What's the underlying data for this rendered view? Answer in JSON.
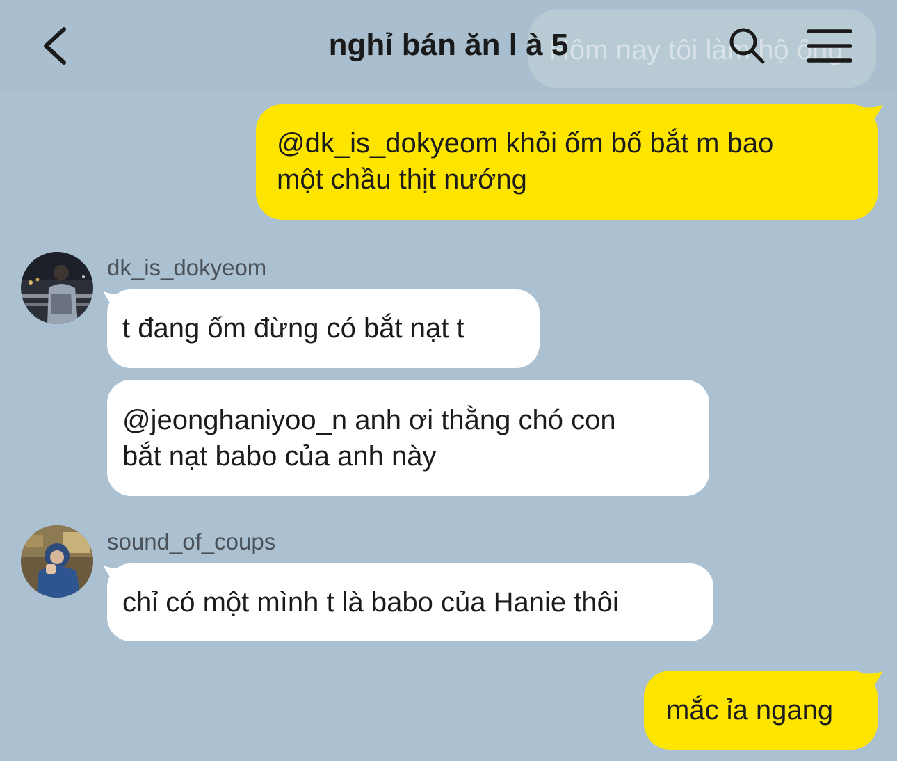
{
  "header": {
    "title": "nghỉ bán ăn l à 5",
    "background_preview_text": "Hôm nay tôi làm hộ ông"
  },
  "messages": [
    {
      "side": "me",
      "text_lines": [
        "@dk_is_dokyeom khỏi ốm bố bắt m bao",
        "một chầu thịt nướng"
      ]
    },
    {
      "side": "other",
      "sender": "dk_is_dokyeom",
      "text": "t đang ốm đừng có bắt nạt t"
    },
    {
      "side": "other",
      "text_lines": [
        "@jeonghaniyoo_n anh ơi thằng chó con",
        "bắt nạt babo của anh này"
      ]
    },
    {
      "side": "other",
      "sender": "sound_of_coups",
      "text": "chỉ có một mình t là babo của Hanie thôi"
    },
    {
      "side": "me",
      "text": "mắc ỉa ngang"
    }
  ],
  "colors": {
    "background": "#abc1d1",
    "my_bubble": "#fee500",
    "other_bubble": "#ffffff"
  },
  "icons": {
    "back": "chevron-left-icon",
    "search": "search-icon",
    "menu": "hamburger-menu-icon"
  }
}
